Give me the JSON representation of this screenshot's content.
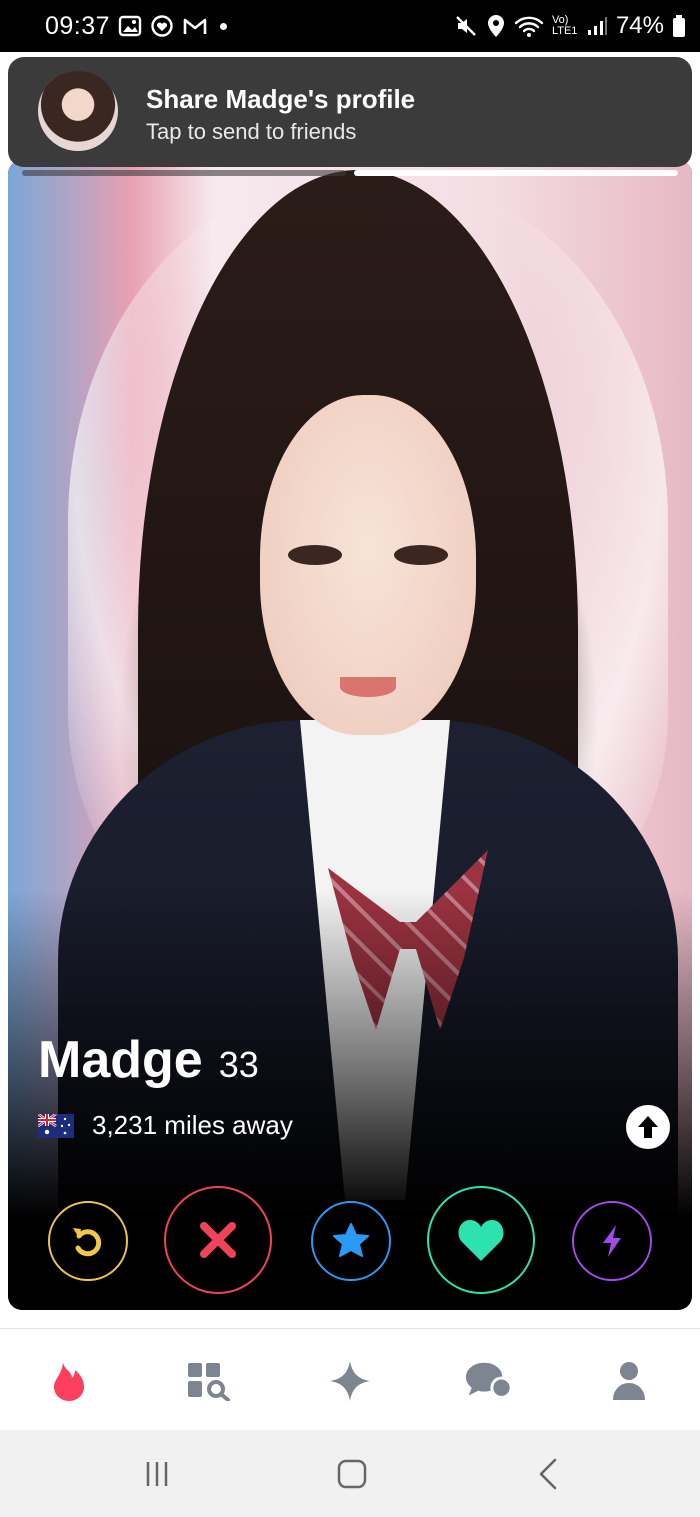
{
  "status_bar": {
    "time": "09:37",
    "battery": "74%",
    "network_label": "Vo) LTE1",
    "left_icons": [
      "gallery-icon",
      "heart-app-icon",
      "gmail-icon"
    ],
    "right_icons": [
      "mute-icon",
      "location-icon",
      "wifi-icon",
      "signal-icon",
      "battery-icon"
    ]
  },
  "notification": {
    "title": "Share Madge's profile",
    "subtitle": "Tap to send to friends"
  },
  "profile": {
    "name": "Madge",
    "age": "33",
    "distance": "3,231 miles away",
    "flag": "australia-flag-icon",
    "photo_count": 2,
    "active_photo": 2
  },
  "actions": [
    {
      "name": "rewind",
      "icon": "rewind-icon",
      "color": "#f0c74a"
    },
    {
      "name": "nope",
      "icon": "close-icon",
      "color": "#f0435a"
    },
    {
      "name": "super-like",
      "icon": "star-icon",
      "color": "#2b9af3"
    },
    {
      "name": "like",
      "icon": "heart-icon",
      "color": "#2ee2b0"
    },
    {
      "name": "boost",
      "icon": "lightning-icon",
      "color": "#a04bea"
    }
  ],
  "bottom_nav": [
    {
      "name": "home",
      "icon": "flame-icon",
      "active": true,
      "color": "#fd3f5e"
    },
    {
      "name": "explore",
      "icon": "explore-icon",
      "active": false,
      "color": "#7c8591"
    },
    {
      "name": "top-picks",
      "icon": "sparkle-icon",
      "active": false,
      "color": "#7c8591"
    },
    {
      "name": "messages",
      "icon": "chat-icon",
      "active": false,
      "color": "#7c8591"
    },
    {
      "name": "profile",
      "icon": "person-icon",
      "active": false,
      "color": "#7c8591"
    }
  ],
  "system_nav": [
    "recents-icon",
    "home-icon",
    "back-icon"
  ]
}
